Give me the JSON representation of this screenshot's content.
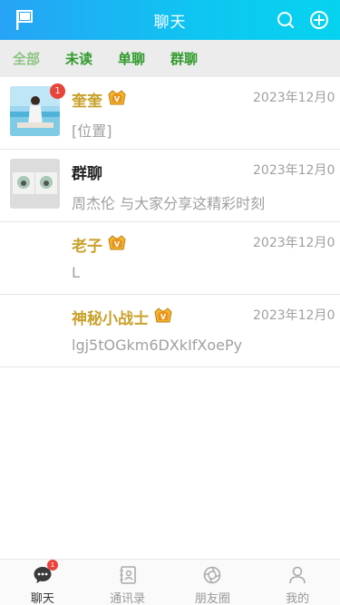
{
  "header": {
    "title": "聊天"
  },
  "tabs": [
    {
      "label": "全部",
      "active": true
    },
    {
      "label": "未读",
      "active": false
    },
    {
      "label": "单聊",
      "active": false
    },
    {
      "label": "群聊",
      "active": false
    }
  ],
  "chats": [
    {
      "name": "奎奎",
      "time": "2023年12月0",
      "message": "[位置]",
      "badge": "1",
      "vip": true,
      "avatar": "photo"
    },
    {
      "name": "群聊",
      "time": "2023年12月0",
      "message": "周杰伦 与大家分享这精彩时刻",
      "badge": "",
      "vip": false,
      "avatar": "group"
    },
    {
      "name": "老子",
      "time": "2023年12月0",
      "message": "L",
      "badge": "",
      "vip": true,
      "avatar": "none"
    },
    {
      "name": "神秘小战士",
      "time": "2023年12月0",
      "message": "lgj5tOGkm6DXkIfXoePy",
      "badge": "",
      "vip": true,
      "avatar": "none"
    }
  ],
  "tabbar": [
    {
      "label": "聊天",
      "icon": "chat-icon",
      "active": true,
      "badge": "1"
    },
    {
      "label": "通讯录",
      "icon": "contacts-icon",
      "active": false,
      "badge": ""
    },
    {
      "label": "朋友圈",
      "icon": "moments-icon",
      "active": false,
      "badge": ""
    },
    {
      "label": "我的",
      "icon": "profile-icon",
      "active": false,
      "badge": ""
    }
  ],
  "colors": {
    "header_start": "#27a3f5",
    "header_end": "#06d3ef",
    "tab_active": "#8ec483",
    "tab_inactive": "#2f9a2a",
    "vip_name": "#c9a22c",
    "badge": "#e8443a"
  }
}
